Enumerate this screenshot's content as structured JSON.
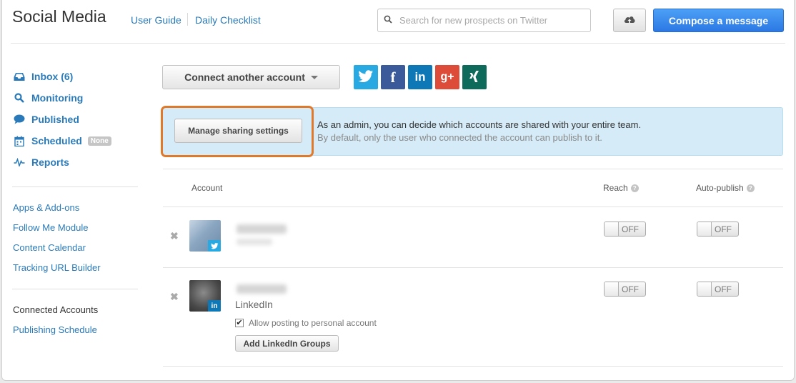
{
  "header": {
    "title": "Social Media",
    "links": [
      "User Guide",
      "Daily Checklist"
    ],
    "search_placeholder": "Search for new prospects on Twitter",
    "compose_label": "Compose a message"
  },
  "sidebar": {
    "nav": [
      {
        "label": "Inbox (6)",
        "icon": "inbox-icon"
      },
      {
        "label": "Monitoring",
        "icon": "search-icon"
      },
      {
        "label": "Published",
        "icon": "chat-bubble-icon"
      },
      {
        "label": "Scheduled",
        "icon": "calendar-icon",
        "badge": "None"
      },
      {
        "label": "Reports",
        "icon": "pulse-icon"
      }
    ],
    "tools": [
      "Apps & Add-ons",
      "Follow Me Module",
      "Content Calendar",
      "Tracking URL Builder"
    ],
    "connected_accounts": "Connected Accounts",
    "publishing_schedule": "Publishing Schedule"
  },
  "main": {
    "connect_label": "Connect another account",
    "networks": [
      {
        "name": "twitter",
        "color": "#29a9e1"
      },
      {
        "name": "facebook",
        "color": "#3b5a9a"
      },
      {
        "name": "linkedin",
        "color": "#0e77b5"
      },
      {
        "name": "google-plus",
        "color": "#dd4b39"
      },
      {
        "name": "xing",
        "color": "#0e6b5c"
      }
    ],
    "network_glyphs": {
      "facebook": "f",
      "linkedin": "in",
      "google_plus": "g+"
    },
    "manage_label": "Manage sharing settings",
    "info_line1": "As an admin, you can decide which accounts are shared with your entire team.",
    "info_line2": "By default, only the user who connected the account can publish to it.",
    "table": {
      "headers": {
        "account": "Account",
        "reach": "Reach",
        "auto_publish": "Auto-publish"
      },
      "help_glyph": "?",
      "remove_glyph": "✖",
      "rows": [
        {
          "network": "twitter",
          "reach": "OFF",
          "auto_publish": "OFF"
        },
        {
          "network": "linkedin",
          "network_label": "LinkedIn",
          "reach": "OFF",
          "auto_publish": "OFF",
          "allow_personal": "Allow posting to personal account",
          "allow_checked": true,
          "add_groups": "Add LinkedIn Groups"
        }
      ]
    }
  }
}
